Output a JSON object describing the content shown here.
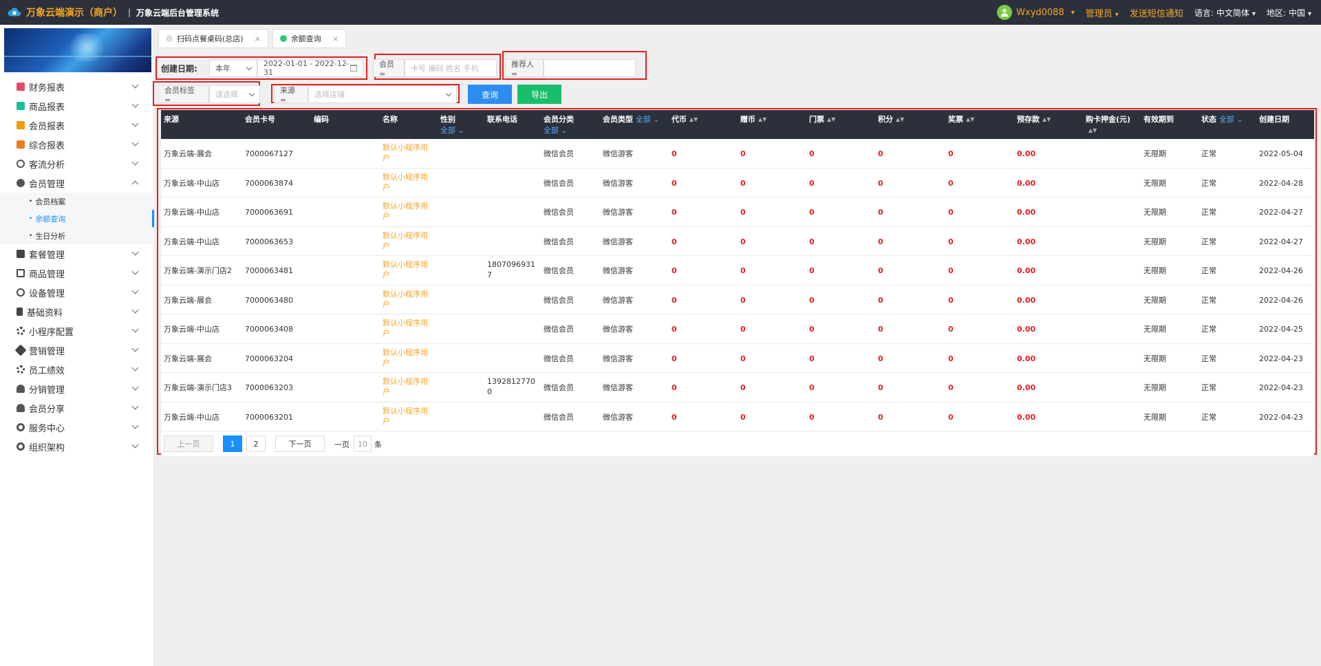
{
  "header": {
    "app_title": "万象云端演示（商户）",
    "separator": "|",
    "system_title": "万象云端后台管理系统",
    "username": "Wxyd0088",
    "role": "管理员",
    "sms": "发送短信通知",
    "language_label": "语言:",
    "language_value": "中文简体",
    "region_label": "地区:",
    "region_value": "中国"
  },
  "sidebar": {
    "items": [
      {
        "label": "财务报表",
        "icon": "finance-icon",
        "color": "#e84a5f"
      },
      {
        "label": "商品报表",
        "icon": "goods-report-icon",
        "color": "#1abc9c"
      },
      {
        "label": "会员报表",
        "icon": "member-report-icon",
        "color": "#f39c12"
      },
      {
        "label": "综合报表",
        "icon": "layers-icon",
        "color": "#e67e22"
      },
      {
        "label": "客流分析",
        "icon": "target-icon",
        "color": "#555555"
      },
      {
        "label": "会员管理",
        "icon": "user-icon",
        "color": "#555555"
      }
    ],
    "sub_items": [
      "会员档案",
      "余额查询",
      "生日分析"
    ],
    "items2": [
      {
        "label": "套餐管理",
        "icon": "package-icon"
      },
      {
        "label": "商品管理",
        "icon": "exchange-icon"
      },
      {
        "label": "设备管理",
        "icon": "device-icon"
      },
      {
        "label": "基础资料",
        "icon": "file-icon"
      },
      {
        "label": "小程序配置",
        "icon": "gear-icon"
      },
      {
        "label": "营销管理",
        "icon": "tag-icon"
      },
      {
        "label": "员工绩效",
        "icon": "gear-icon"
      },
      {
        "label": "分销管理",
        "icon": "users-icon"
      },
      {
        "label": "会员分享",
        "icon": "share-icon"
      },
      {
        "label": "服务中心",
        "icon": "service-icon"
      },
      {
        "label": "组织架构",
        "icon": "org-icon"
      }
    ]
  },
  "tabs": [
    {
      "label": "扫码点餐桌码(总店)",
      "close": "×"
    },
    {
      "label": "余额查询",
      "close": "×"
    }
  ],
  "filters": {
    "date_label": "创建日期:",
    "date_range_option": "本年",
    "date_range": "2022-01-01 - 2022-12-31",
    "member_label": "会员 ≈",
    "member_placeholder": "卡号 编码 姓名 手机",
    "referrer_label": "推荐人 =",
    "tag_label": "会员标签 =",
    "tag_placeholder": "请选择",
    "source_label": "来源 =",
    "source_placeholder": "选择店铺",
    "query_button": "查询",
    "export_button": "导出"
  },
  "table": {
    "headers": {
      "source": "来源",
      "card_no": "会员卡号",
      "code": "编码",
      "name": "名称",
      "gender": "性别",
      "gender_filter": "全部",
      "phone": "联系电话",
      "category": "会员分类",
      "category_filter": "全部",
      "type": "会员类型",
      "type_filter": "全部",
      "coins": "代币",
      "gift_coins": "赠币",
      "tickets": "门票",
      "points": "积分",
      "lottery": "奖票",
      "deposit": "预存款",
      "card_deposit": "购卡押金(元)",
      "valid_until": "有效期到",
      "status": "状态",
      "status_filter": "全部",
      "created": "创建日期"
    },
    "rows": [
      {
        "source": "万象云端-展会",
        "card_no": "7000067127",
        "name": "默认小程序用户",
        "phone": "",
        "category": "微信会员",
        "type": "微信游客",
        "coins": "0",
        "gift_coins": "0",
        "tickets": "0",
        "points": "0",
        "lottery": "0",
        "deposit": "0.00",
        "valid_until": "无限期",
        "status": "正常",
        "created": "2022-05-04"
      },
      {
        "source": "万象云端-中山店",
        "card_no": "7000063874",
        "name": "默认小程序用户",
        "phone": "",
        "category": "微信会员",
        "type": "微信游客",
        "coins": "0",
        "gift_coins": "0",
        "tickets": "0",
        "points": "0",
        "lottery": "0",
        "deposit": "0.00",
        "valid_until": "无限期",
        "status": "正常",
        "created": "2022-04-28"
      },
      {
        "source": "万象云端-中山店",
        "card_no": "7000063691",
        "name": "默认小程序用户",
        "phone": "",
        "category": "微信会员",
        "type": "微信游客",
        "coins": "0",
        "gift_coins": "0",
        "tickets": "0",
        "points": "0",
        "lottery": "0",
        "deposit": "0.00",
        "valid_until": "无限期",
        "status": "正常",
        "created": "2022-04-27"
      },
      {
        "source": "万象云端-中山店",
        "card_no": "7000063653",
        "name": "默认小程序用户",
        "phone": "",
        "category": "微信会员",
        "type": "微信游客",
        "coins": "0",
        "gift_coins": "0",
        "tickets": "0",
        "points": "0",
        "lottery": "0",
        "deposit": "0.00",
        "valid_until": "无限期",
        "status": "正常",
        "created": "2022-04-27"
      },
      {
        "source": "万象云端-演示门店2",
        "card_no": "7000063481",
        "name": "默认小程序用户",
        "phone": "18070969317",
        "category": "微信会员",
        "type": "微信游客",
        "coins": "0",
        "gift_coins": "0",
        "tickets": "0",
        "points": "0",
        "lottery": "0",
        "deposit": "0.00",
        "valid_until": "无限期",
        "status": "正常",
        "created": "2022-04-26"
      },
      {
        "source": "万象云端-展会",
        "card_no": "7000063480",
        "name": "默认小程序用户",
        "phone": "",
        "category": "微信会员",
        "type": "微信游客",
        "coins": "0",
        "gift_coins": "0",
        "tickets": "0",
        "points": "0",
        "lottery": "0",
        "deposit": "0.00",
        "valid_until": "无限期",
        "status": "正常",
        "created": "2022-04-26"
      },
      {
        "source": "万象云端-中山店",
        "card_no": "7000063408",
        "name": "默认小程序用户",
        "phone": "",
        "category": "微信会员",
        "type": "微信游客",
        "coins": "0",
        "gift_coins": "0",
        "tickets": "0",
        "points": "0",
        "lottery": "0",
        "deposit": "0.00",
        "valid_until": "无限期",
        "status": "正常",
        "created": "2022-04-25"
      },
      {
        "source": "万象云端-展会",
        "card_no": "7000063204",
        "name": "默认小程序用户",
        "phone": "",
        "category": "微信会员",
        "type": "微信游客",
        "coins": "0",
        "gift_coins": "0",
        "tickets": "0",
        "points": "0",
        "lottery": "0",
        "deposit": "0.00",
        "valid_until": "无限期",
        "status": "正常",
        "created": "2022-04-23"
      },
      {
        "source": "万象云端-演示门店3",
        "card_no": "7000063203",
        "name": "默认小程序用户",
        "phone": "13928127700",
        "category": "微信会员",
        "type": "微信游客",
        "coins": "0",
        "gift_coins": "0",
        "tickets": "0",
        "points": "0",
        "lottery": "0",
        "deposit": "0.00",
        "valid_until": "无限期",
        "status": "正常",
        "created": "2022-04-23"
      },
      {
        "source": "万象云端-中山店",
        "card_no": "7000063201",
        "name": "默认小程序用户",
        "phone": "",
        "category": "微信会员",
        "type": "微信游客",
        "coins": "0",
        "gift_coins": "0",
        "tickets": "0",
        "points": "0",
        "lottery": "0",
        "deposit": "0.00",
        "valid_until": "无限期",
        "status": "正常",
        "created": "2022-04-23"
      }
    ]
  },
  "pager": {
    "prev": "上一页",
    "page1": "1",
    "page2": "2",
    "next": "下一页",
    "per_page_label": "一页",
    "per_page_value": "10",
    "per_page_unit": "条"
  },
  "colors": {
    "accent": "#f5a623",
    "topbar": "#2b303b",
    "primary": "#1890ff",
    "export": "#19be6b",
    "highlight_box": "#e02020"
  }
}
